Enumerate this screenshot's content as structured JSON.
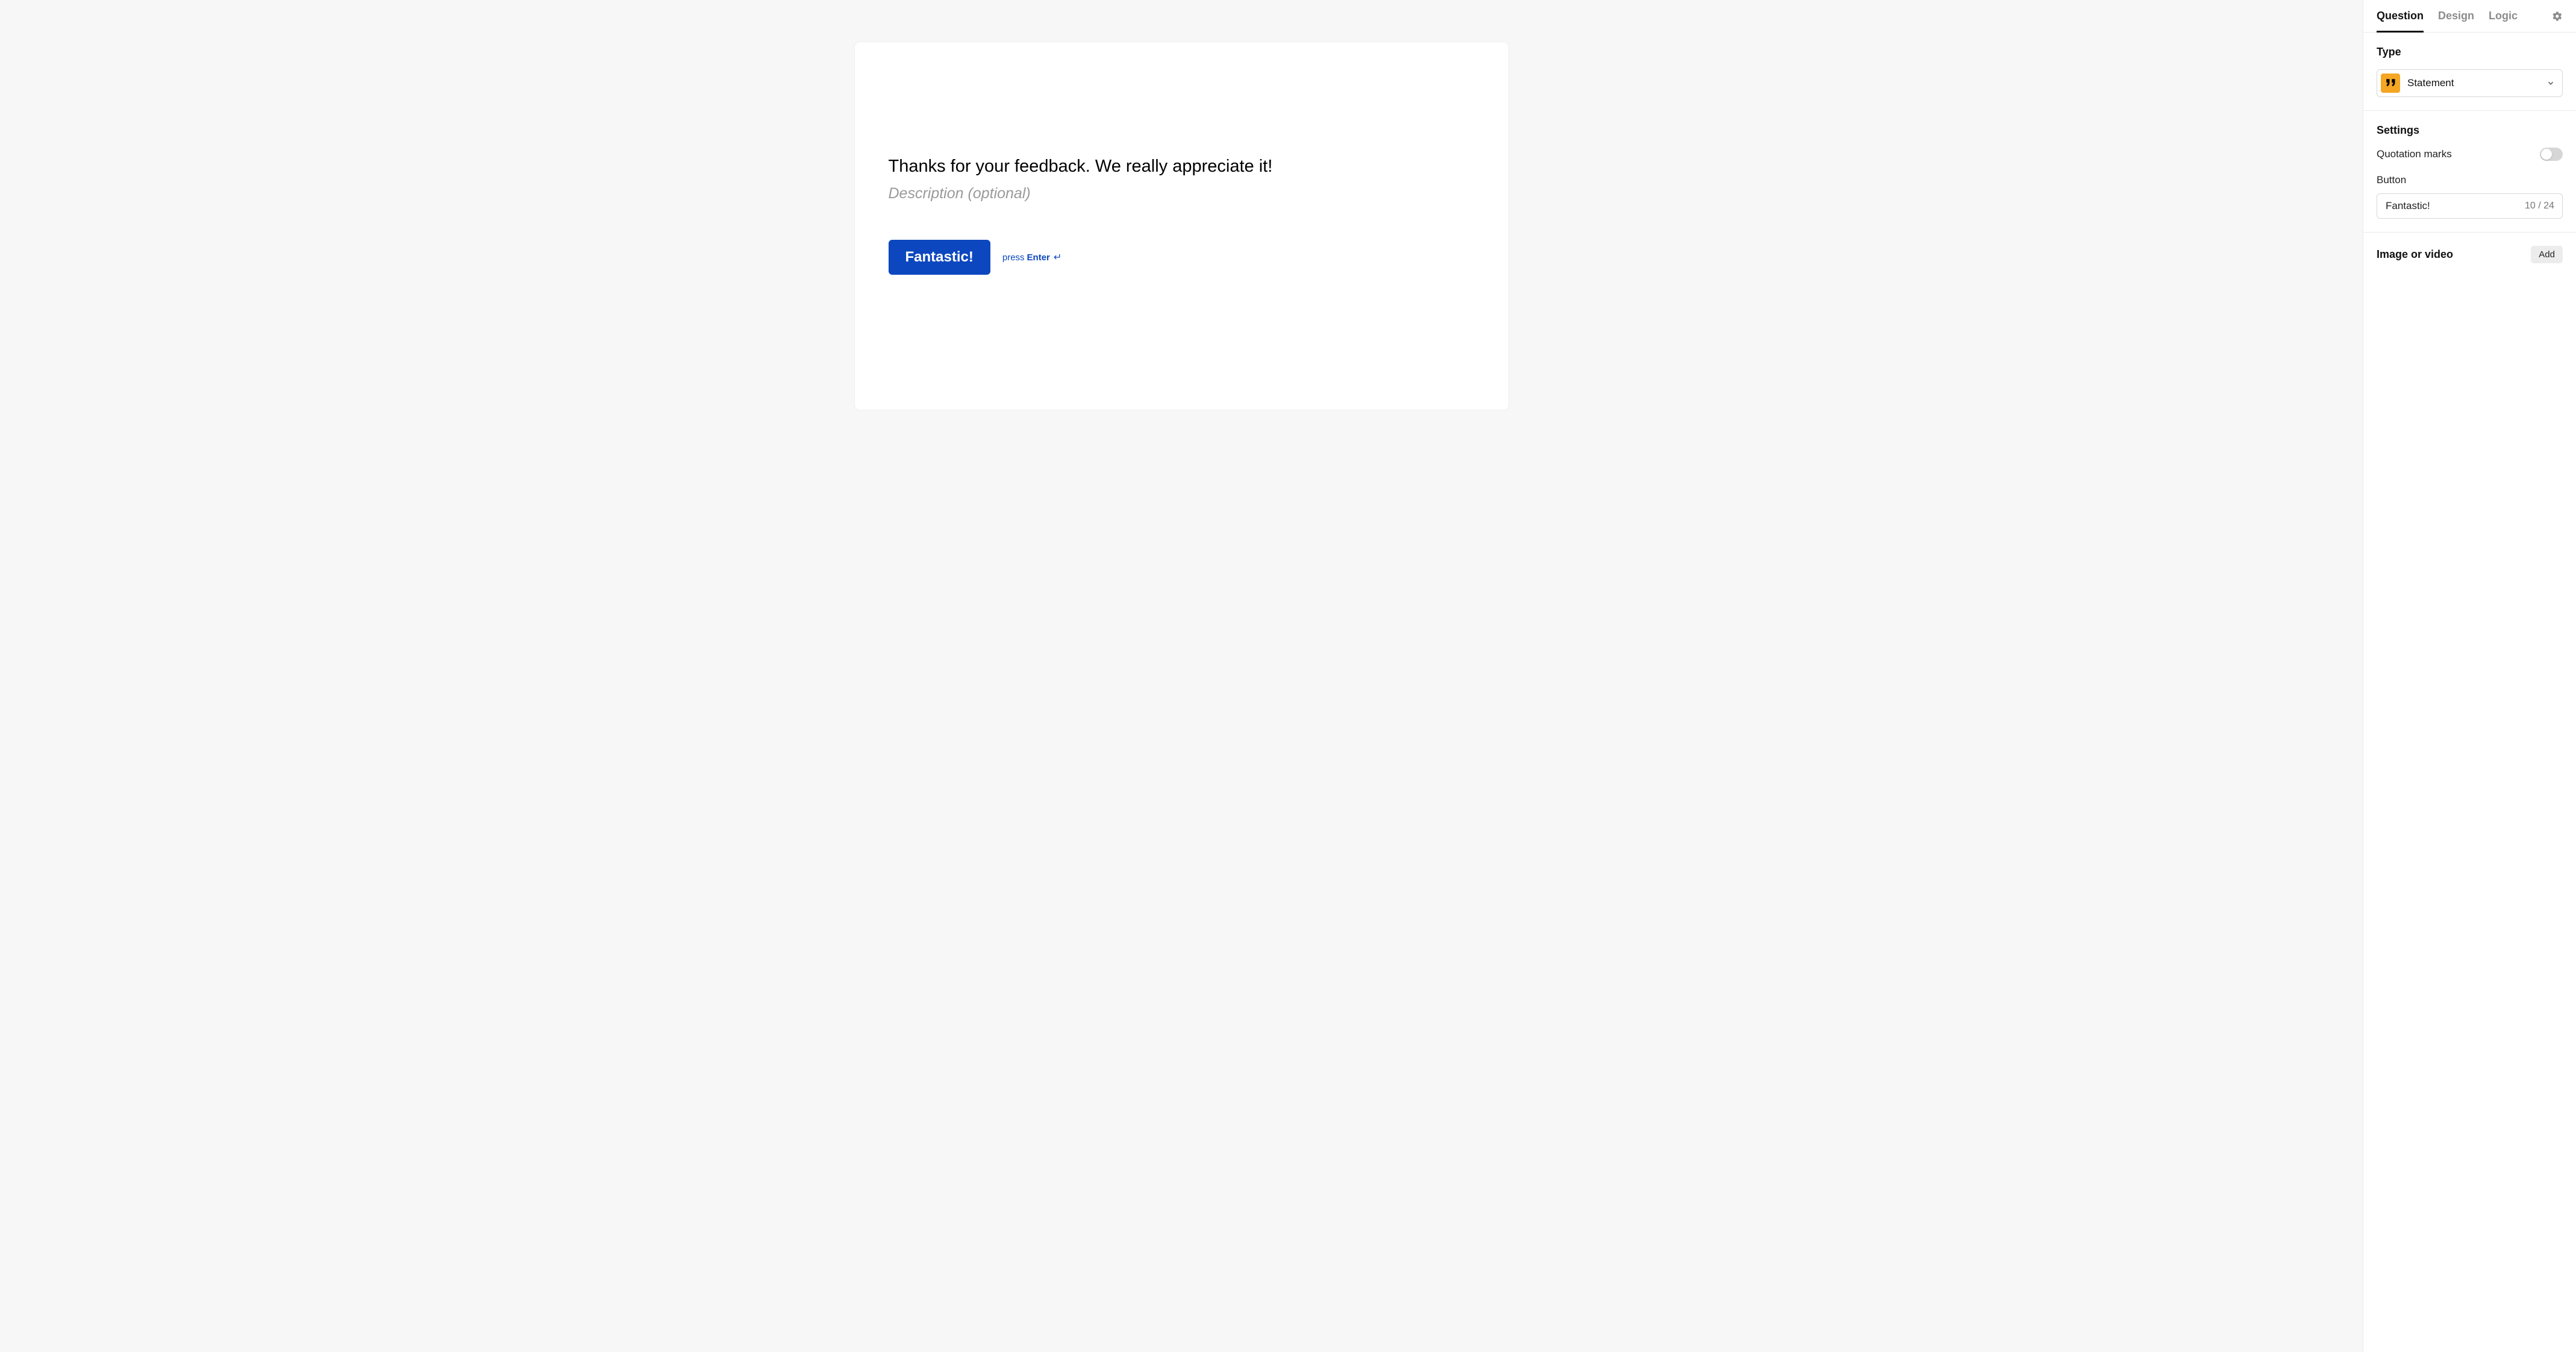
{
  "canvas": {
    "title": "Thanks for your feedback. We really appreciate it!",
    "description_placeholder": "Description (optional)",
    "button_label": "Fantastic!",
    "hint_press": "press",
    "hint_enter": "Enter"
  },
  "sidebar": {
    "tabs": {
      "question": "Question",
      "design": "Design",
      "logic": "Logic"
    },
    "type_section": {
      "title": "Type",
      "selected": "Statement",
      "icon": "quote-icon"
    },
    "settings_section": {
      "title": "Settings",
      "quotation_marks_label": "Quotation marks",
      "quotation_marks_on": false,
      "button_label": "Button",
      "button_value": "Fantastic!",
      "button_char_count": "10 / 24"
    },
    "media_section": {
      "title": "Image or video",
      "add_label": "Add"
    }
  }
}
